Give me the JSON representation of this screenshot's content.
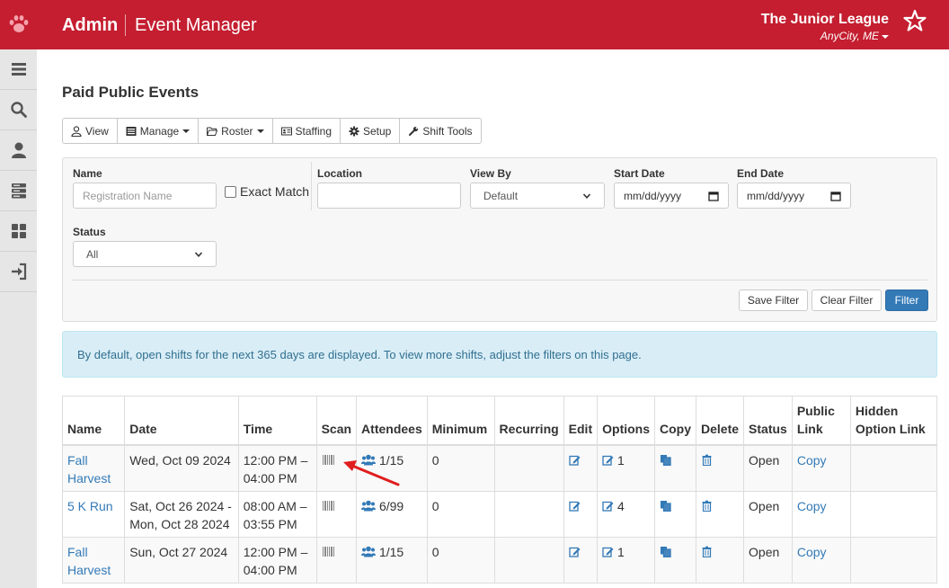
{
  "header": {
    "brand": "Admin",
    "section": "Event Manager",
    "org_name": "The Junior League",
    "org_city": "AnyCity, ME",
    "accent_color": "#c41e30"
  },
  "sidebar": {
    "items": [
      {
        "icon": "menu-icon"
      },
      {
        "icon": "search-icon"
      },
      {
        "icon": "user-icon"
      },
      {
        "icon": "server-icon"
      },
      {
        "icon": "grid-icon"
      },
      {
        "icon": "sign-out-icon"
      }
    ]
  },
  "page": {
    "title": "Paid Public Events"
  },
  "toolbar": {
    "view": "View",
    "manage": "Manage",
    "roster": "Roster",
    "staffing": "Staffing",
    "setup": "Setup",
    "shift_tools": "Shift Tools"
  },
  "filters": {
    "name_label": "Name",
    "name_placeholder": "Registration Name",
    "name_value": "",
    "exact_match_label": "Exact Match",
    "exact_match_checked": false,
    "location_label": "Location",
    "location_value": "",
    "view_by_label": "View By",
    "view_by_value": "Default",
    "start_date_label": "Start Date",
    "start_date_placeholder": "mm/dd/yyyy",
    "end_date_label": "End Date",
    "end_date_placeholder": "mm/dd/yyyy",
    "status_label": "Status",
    "status_value": "All",
    "save_filter": "Save Filter",
    "clear_filter": "Clear Filter",
    "filter": "Filter"
  },
  "info_message": "By default, open shifts for the next 365 days are displayed. To view more shifts, adjust the filters on this page.",
  "table": {
    "headers": {
      "name": "Name",
      "date": "Date",
      "time": "Time",
      "scan": "Scan",
      "attendees": "Attendees",
      "minimum": "Minimum",
      "recurring": "Recurring",
      "edit": "Edit",
      "options": "Options",
      "copy": "Copy",
      "delete": "Delete",
      "status": "Status",
      "public_link_1": "Public",
      "public_link_2": "Link",
      "hidden_option_link_1": "Hidden",
      "hidden_option_link_2": "Option Link"
    },
    "rows": [
      {
        "name1": "Fall",
        "name2": "Harvest",
        "date1": "Wed, Oct 09 2024",
        "date2": "",
        "time1": "12:00 PM –",
        "time2": "04:00 PM",
        "attendees": "1/15",
        "minimum": "0",
        "recurring": "",
        "options": "1",
        "status": "Open",
        "public_link": "Copy",
        "hidden_option_link": ""
      },
      {
        "name1": "5 K Run",
        "name2": "",
        "date1": "Sat, Oct 26 2024 -",
        "date2": "Mon, Oct 28 2024",
        "time1": "08:00 AM –",
        "time2": "03:55 PM",
        "attendees": "6/99",
        "minimum": "0",
        "recurring": "",
        "options": "4",
        "status": "Open",
        "public_link": "Copy",
        "hidden_option_link": ""
      },
      {
        "name1": "Fall",
        "name2": "Harvest",
        "date1": "Sun, Oct 27 2024",
        "date2": "",
        "time1": "12:00 PM –",
        "time2": "04:00 PM",
        "attendees": "1/15",
        "minimum": "0",
        "recurring": "",
        "options": "1",
        "status": "Open",
        "public_link": "Copy",
        "hidden_option_link": ""
      }
    ]
  }
}
